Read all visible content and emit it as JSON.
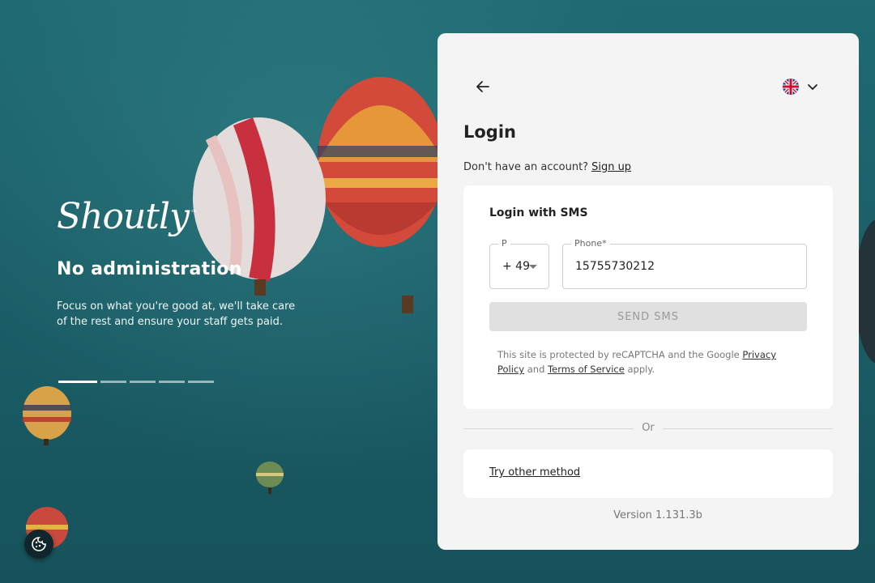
{
  "brand": {
    "logo_text": "Shoutly",
    "trademark": "™"
  },
  "hero": {
    "title": "No administration",
    "description": "Focus on what you're good at, we'll take care of the rest and ensure your staff gets paid."
  },
  "carousel": {
    "total_slides": 5,
    "active_index": 0
  },
  "login": {
    "title": "Login",
    "no_account_text": "Don't have an account?",
    "signup_link": "Sign up",
    "sms": {
      "title": "Login with SMS",
      "prefix_label": "P",
      "prefix_value": "+ 49",
      "phone_label": "Phone*",
      "phone_value": "15755730212",
      "send_button": "SEND SMS"
    },
    "recaptcha": {
      "text1": "This site is protected by reCAPTCHA and the Google",
      "privacy_link": "Privacy Policy",
      "and": "and",
      "terms_link": "Terms of Service",
      "apply": "apply."
    },
    "divider_text": "Or",
    "other_method_link": "Try other method",
    "version": "Version 1.131.3b"
  },
  "language": {
    "icon": "uk-flag-icon"
  },
  "colors": {
    "background": "#1b5f68",
    "card": "#f4f4f4",
    "button_disabled": "#e0e0e0"
  }
}
